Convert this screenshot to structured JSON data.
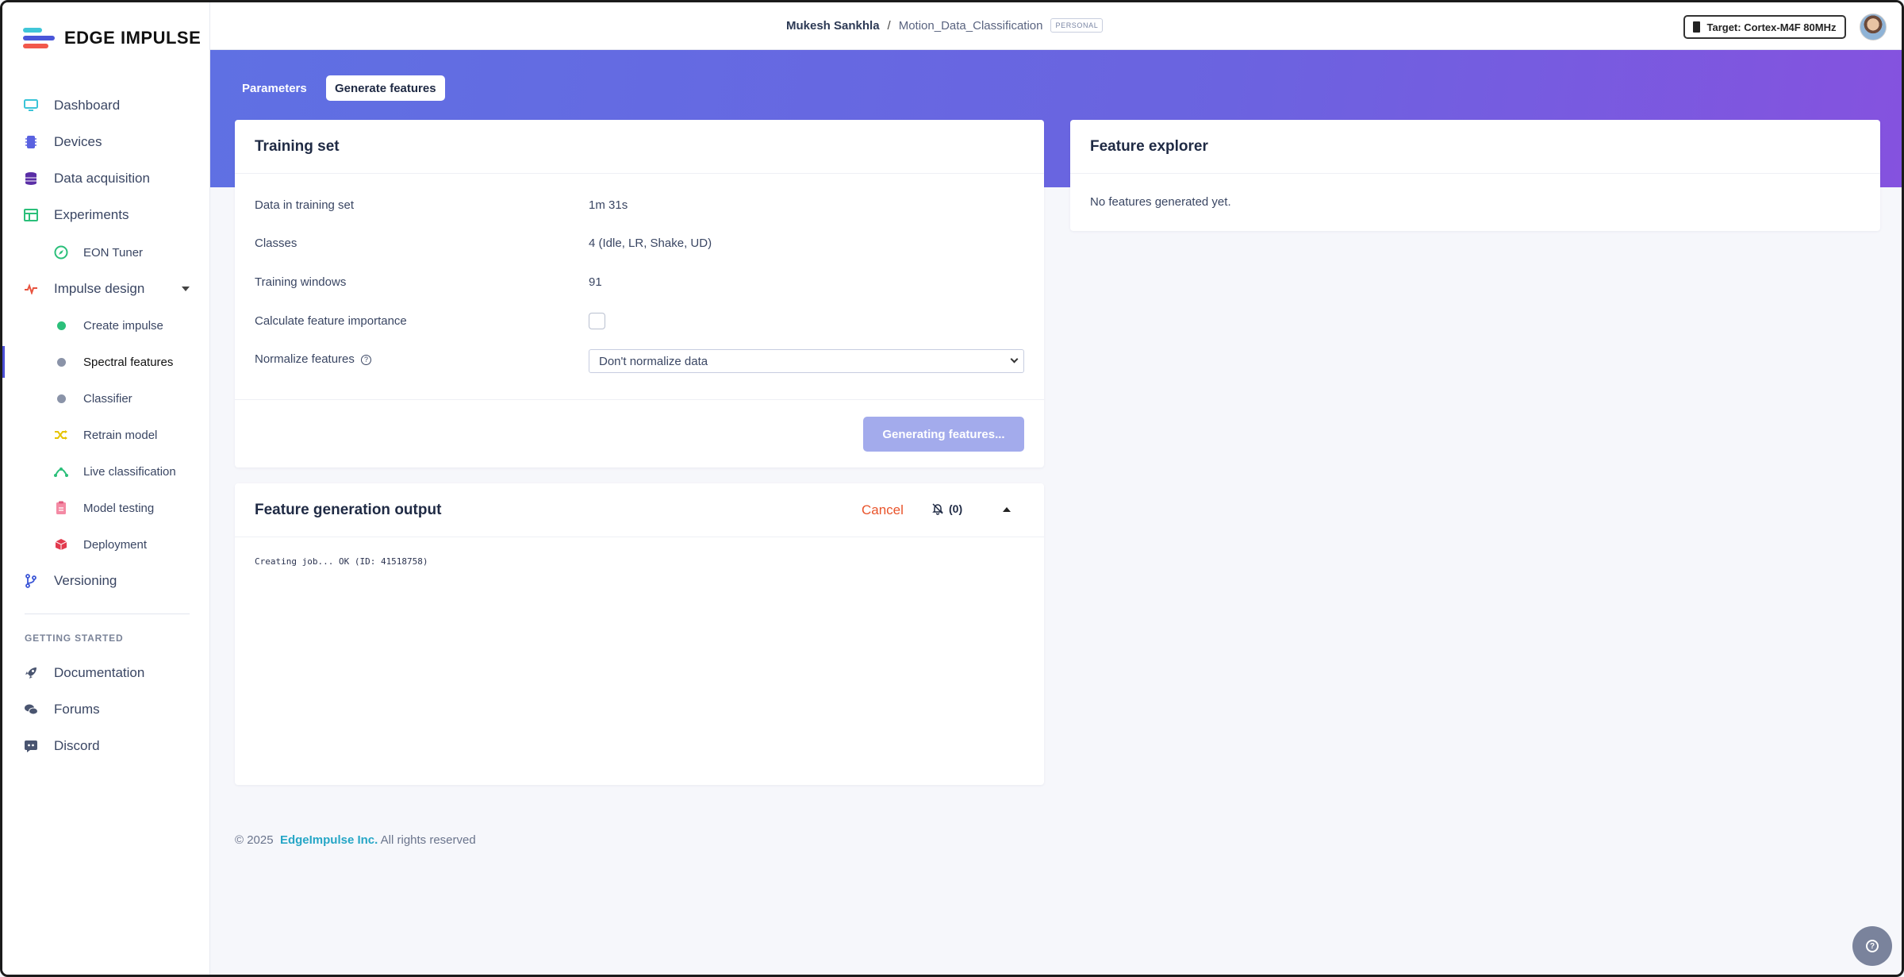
{
  "app": {
    "name": "EDGE IMPULSE"
  },
  "topbar": {
    "user": "Mukesh Sankhla",
    "separator": "/",
    "project": "Motion_Data_Classification",
    "badge": "PERSONAL",
    "target": "Target: Cortex-M4F 80MHz"
  },
  "sidebar": {
    "items": [
      {
        "label": "Dashboard",
        "icon": "monitor-icon"
      },
      {
        "label": "Devices",
        "icon": "chip-icon"
      },
      {
        "label": "Data acquisition",
        "icon": "database-icon"
      },
      {
        "label": "Experiments",
        "icon": "table-icon"
      },
      {
        "label": "EON Tuner",
        "icon": "compass-icon"
      },
      {
        "label": "Impulse design",
        "icon": "pulse-icon"
      },
      {
        "label": "Create impulse",
        "icon": "dot-icon"
      },
      {
        "label": "Spectral features",
        "icon": "dot-icon"
      },
      {
        "label": "Classifier",
        "icon": "dot-icon"
      },
      {
        "label": "Retrain model",
        "icon": "shuffle-icon"
      },
      {
        "label": "Live classification",
        "icon": "graph-icon"
      },
      {
        "label": "Model testing",
        "icon": "clipboard-icon"
      },
      {
        "label": "Deployment",
        "icon": "box-icon"
      },
      {
        "label": "Versioning",
        "icon": "branch-icon"
      }
    ],
    "section_label": "GETTING STARTED",
    "links": [
      {
        "label": "Documentation",
        "icon": "rocket-icon"
      },
      {
        "label": "Forums",
        "icon": "chat-icon"
      },
      {
        "label": "Discord",
        "icon": "discord-icon"
      }
    ]
  },
  "tabs": {
    "parameters": "Parameters",
    "generate": "Generate features"
  },
  "training_set": {
    "title": "Training set",
    "rows": [
      {
        "label": "Data in training set",
        "value": "1m 31s"
      },
      {
        "label": "Classes",
        "value": "4 (Idle, LR, Shake, UD)"
      },
      {
        "label": "Training windows",
        "value": "91"
      }
    ],
    "feature_importance_label": "Calculate feature importance",
    "feature_importance_checked": false,
    "normalize_label": "Normalize features",
    "normalize_value": "Don't normalize data",
    "button": "Generating features..."
  },
  "output": {
    "title": "Feature generation output",
    "cancel": "Cancel",
    "notif_count": "(0)",
    "log": "Creating job... OK (ID: 41518758)"
  },
  "explorer": {
    "title": "Feature explorer",
    "empty": "No features generated yet."
  },
  "footer": {
    "copyright": "© 2025",
    "company": "EdgeImpulse Inc.",
    "rights": "All rights reserved"
  },
  "colors": {
    "accent": "#4b4fd6",
    "hero_start": "#5f70e3",
    "hero_end": "#8552df",
    "cancel": "#e9542b",
    "button_disabled": "#a3abec"
  }
}
